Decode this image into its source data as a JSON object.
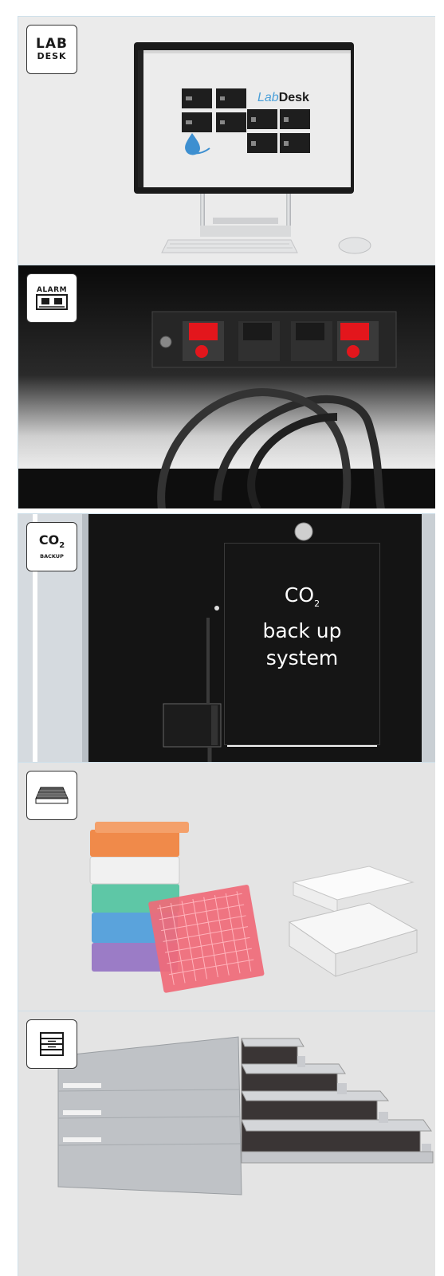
{
  "panels": [
    {
      "badge_line1": "LAB",
      "badge_line2": "DESK",
      "screen_logo_prefix": "Lab",
      "screen_logo_suffix": "Desk"
    },
    {
      "badge_line1": "ALARM"
    },
    {
      "badge_co": "CO",
      "badge_sub": "2",
      "badge_line2": "BACKUP",
      "sign_line1": "CO",
      "sign_sub": "2",
      "sign_line2": "back up",
      "sign_line3": "system"
    },
    {
      "icon": "tube-rack-icon"
    },
    {
      "icon": "drawer-rack-icon"
    }
  ],
  "colors": {
    "alarm_red": "#e3161c",
    "accent_blue": "#4a9fd8"
  }
}
